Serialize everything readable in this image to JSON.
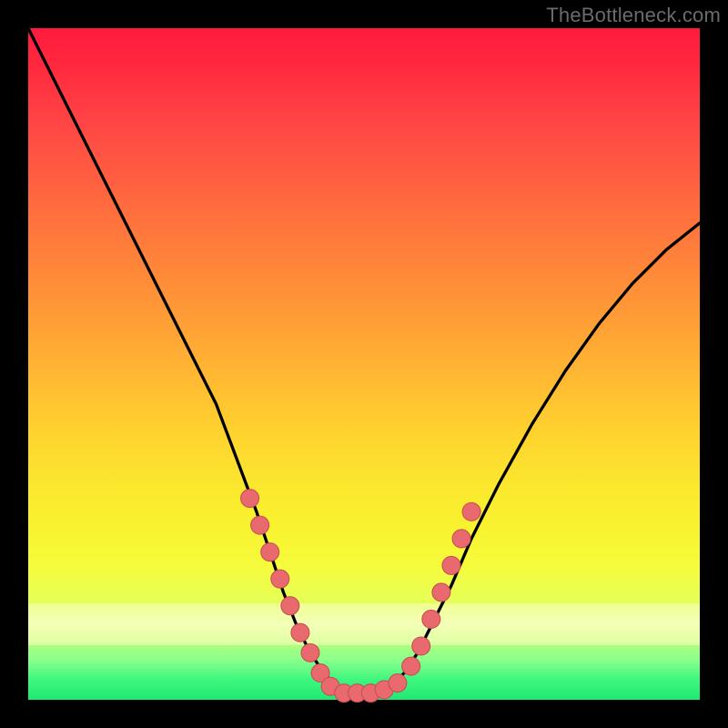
{
  "watermark": "TheBottleneck.com",
  "colors": {
    "curve_stroke": "#000000",
    "marker_fill": "#e86a6f",
    "marker_stroke": "#c94e54"
  },
  "chart_data": {
    "type": "line",
    "title": "",
    "xlabel": "",
    "ylabel": "",
    "xlim": [
      0,
      100
    ],
    "ylim": [
      0,
      100
    ],
    "grid": false,
    "legend": false,
    "series": [
      {
        "name": "bottleneck-curve",
        "x": [
          0,
          4,
          8,
          12,
          16,
          20,
          24,
          28,
          31,
          34,
          36,
          38,
          40,
          42,
          44,
          46,
          48,
          50,
          52,
          54,
          56,
          58,
          60,
          63,
          66,
          70,
          75,
          80,
          85,
          90,
          95,
          100
        ],
        "y": [
          100,
          92,
          84,
          76,
          68,
          60,
          52,
          44,
          36,
          28,
          22,
          16,
          11,
          7,
          4,
          2,
          1,
          1,
          1,
          2,
          4,
          7,
          11,
          17,
          24,
          32,
          41,
          49,
          56,
          62,
          67,
          71
        ]
      }
    ],
    "markers": {
      "left_cluster": [
        [
          33,
          30
        ],
        [
          34.5,
          26
        ],
        [
          36,
          22
        ],
        [
          37.5,
          18
        ],
        [
          39,
          14
        ],
        [
          40.5,
          10
        ],
        [
          42,
          7
        ],
        [
          43.5,
          4
        ]
      ],
      "bottom_cluster": [
        [
          45,
          2
        ],
        [
          47,
          1
        ],
        [
          49,
          1
        ],
        [
          51,
          1
        ],
        [
          53,
          1.5
        ],
        [
          55,
          2.5
        ]
      ],
      "right_cluster": [
        [
          57,
          5
        ],
        [
          58.5,
          8
        ],
        [
          60,
          12
        ],
        [
          61.5,
          16
        ],
        [
          63,
          20
        ],
        [
          64.5,
          24
        ],
        [
          66,
          28
        ]
      ]
    }
  }
}
